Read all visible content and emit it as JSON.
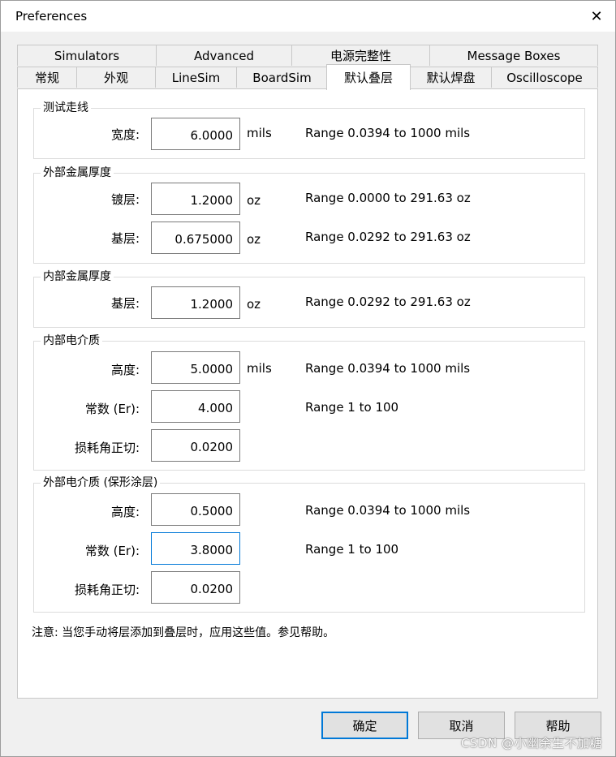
{
  "window": {
    "title": "Preferences",
    "close_glyph": "✕",
    "close_icon": "close-icon"
  },
  "tabs": {
    "row1": [
      "Simulators",
      "Advanced",
      "电源完整性",
      "Message Boxes"
    ],
    "row2": [
      "常规",
      "外观",
      "LineSim",
      "BoardSim",
      "默认叠层",
      "默认焊盘",
      "Oscilloscope"
    ],
    "active": "默认叠层"
  },
  "groups": {
    "test_trace": {
      "title": "测试走线",
      "width_label": "宽度:",
      "width_value": "6.0000",
      "width_unit": "mils",
      "width_range": "Range 0.0394 to 1000 mils"
    },
    "outer_metal": {
      "title": "外部金属厚度",
      "plating_label": "镀层:",
      "plating_value": "1.2000",
      "plating_unit": "oz",
      "plating_range": "Range 0.0000 to 291.63 oz",
      "base_label": "基层:",
      "base_value": "0.675000",
      "base_unit": "oz",
      "base_range": "Range 0.0292 to 291.63 oz"
    },
    "inner_metal": {
      "title": "内部金属厚度",
      "base_label": "基层:",
      "base_value": "1.2000",
      "base_unit": "oz",
      "base_range": "Range 0.0292 to 291.63 oz"
    },
    "inner_dielectric": {
      "title": "内部电介质",
      "height_label": "高度:",
      "height_value": "5.0000",
      "height_unit": "mils",
      "height_range": "Range 0.0394 to 1000 mils",
      "er_label": "常数 (Er):",
      "er_value": "4.000",
      "er_range": "Range 1 to 100",
      "loss_label": "损耗角正切:",
      "loss_value": "0.0200"
    },
    "outer_dielectric": {
      "title": "外部电介质 (保形涂层)",
      "height_label": "高度:",
      "height_value": "0.5000",
      "height_range": "Range 0.0394 to 1000 mils",
      "er_label": "常数 (Er):",
      "er_value": "3.8000",
      "er_range": "Range 1 to 100",
      "loss_label": "损耗角正切:",
      "loss_value": "0.0200"
    }
  },
  "note": "注意: 当您手动将层添加到叠层时，应用这些值。参见帮助。",
  "buttons": {
    "ok": "确定",
    "cancel": "取消",
    "help": "帮助"
  },
  "watermark": "CSDN @小幽余生不加糖",
  "colors": {
    "focus_border": "#0078d7",
    "panel_bg": "#ffffff",
    "window_bg": "#f0f0f0"
  }
}
